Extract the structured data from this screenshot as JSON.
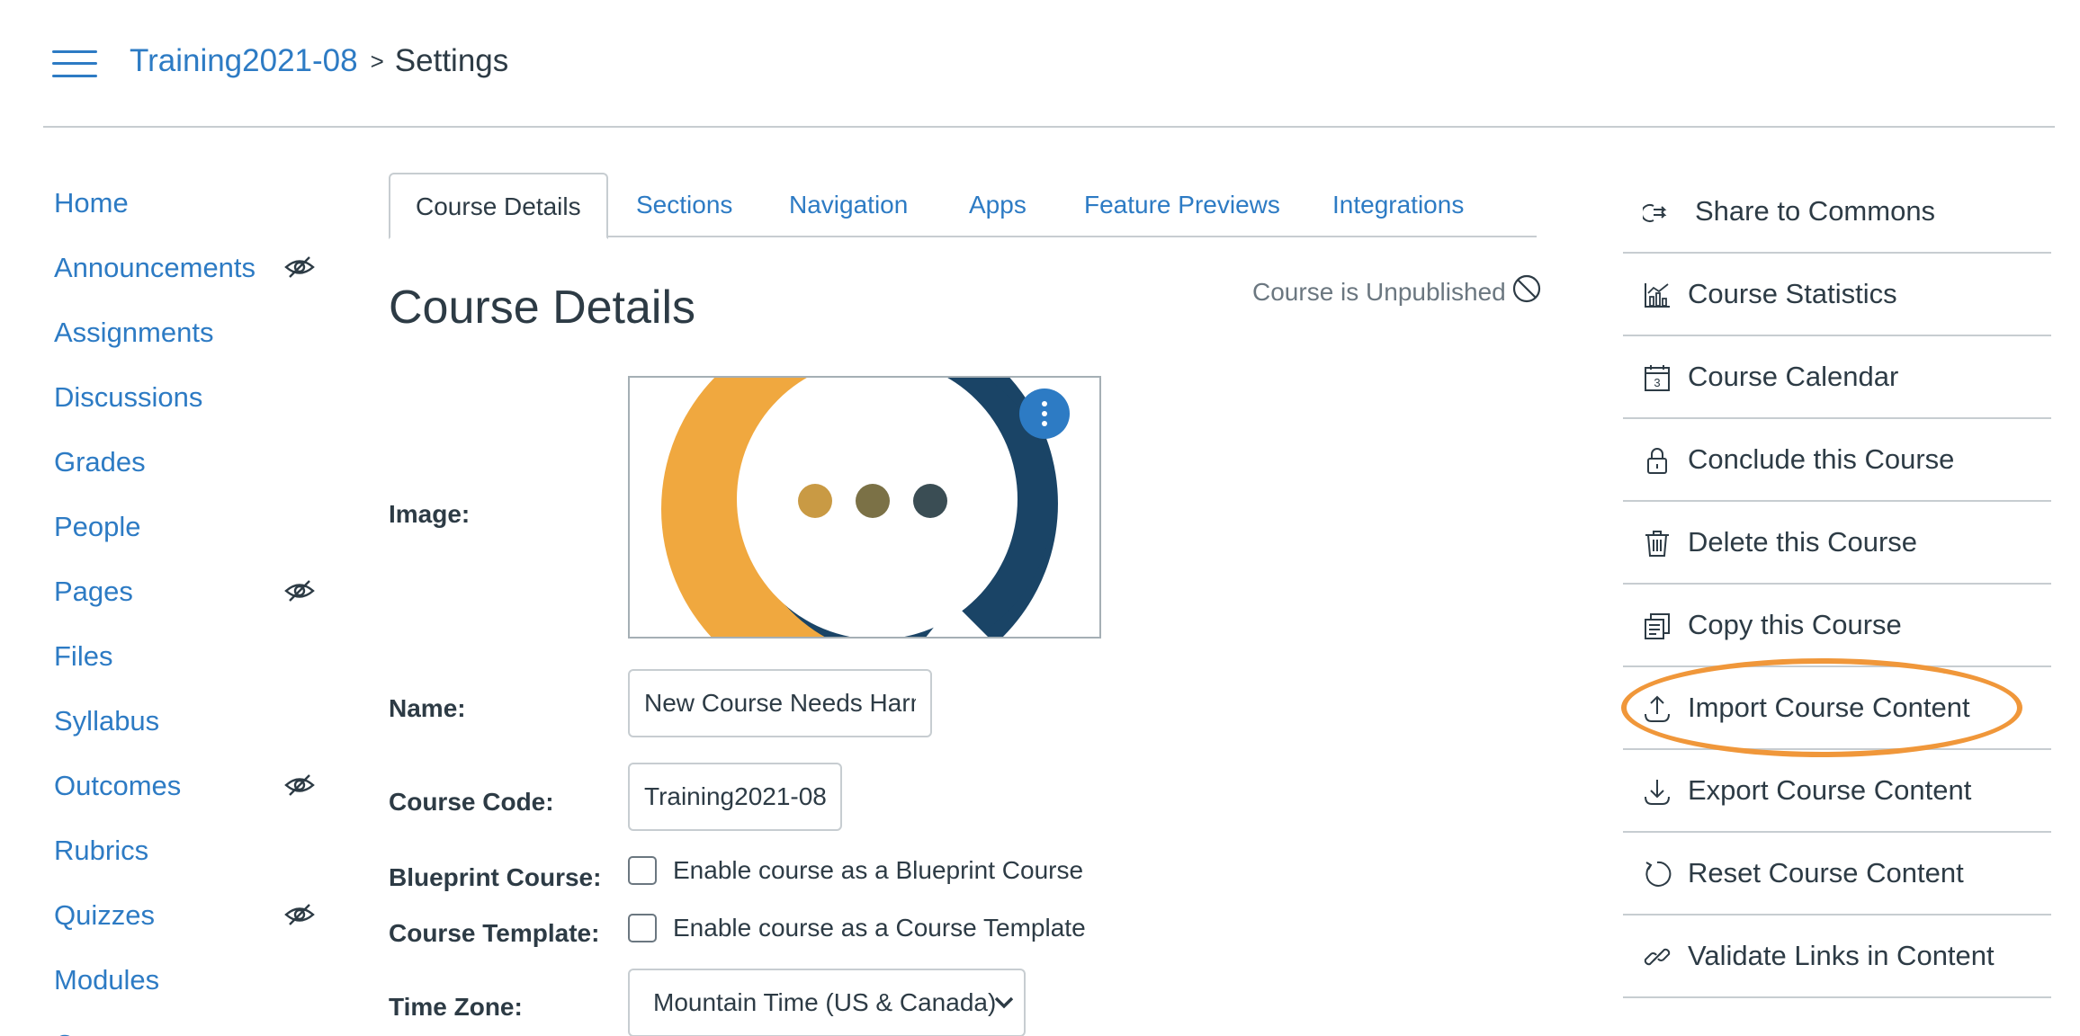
{
  "header": {
    "course_link": "Training2021-08",
    "separator": ">",
    "current_page": "Settings"
  },
  "course_nav": {
    "items": [
      {
        "label": "Home",
        "hidden_icon": false
      },
      {
        "label": "Announcements",
        "hidden_icon": true
      },
      {
        "label": "Assignments",
        "hidden_icon": false
      },
      {
        "label": "Discussions",
        "hidden_icon": false
      },
      {
        "label": "Grades",
        "hidden_icon": false
      },
      {
        "label": "People",
        "hidden_icon": false
      },
      {
        "label": "Pages",
        "hidden_icon": true
      },
      {
        "label": "Files",
        "hidden_icon": false
      },
      {
        "label": "Syllabus",
        "hidden_icon": false
      },
      {
        "label": "Outcomes",
        "hidden_icon": true
      },
      {
        "label": "Rubrics",
        "hidden_icon": false
      },
      {
        "label": "Quizzes",
        "hidden_icon": true
      },
      {
        "label": "Modules",
        "hidden_icon": false
      },
      {
        "label": "Co",
        "hidden_icon": false
      }
    ]
  },
  "tabs": [
    {
      "label": "Course Details",
      "active": true
    },
    {
      "label": "Sections",
      "active": false
    },
    {
      "label": "Navigation",
      "active": false
    },
    {
      "label": "Apps",
      "active": false
    },
    {
      "label": "Feature Previews",
      "active": false
    },
    {
      "label": "Integrations",
      "active": false
    }
  ],
  "main": {
    "title": "Course Details",
    "publish_status": "Course is Unpublished",
    "image_label": "Image:",
    "name_label": "Name:",
    "name_value": "New Course Needs Harmonizing",
    "code_label": "Course Code:",
    "code_value": "Training2021-08",
    "blueprint_label": "Blueprint Course:",
    "blueprint_checkbox": "Enable course as a Blueprint Course",
    "template_label": "Course Template:",
    "template_checkbox": "Enable course as a Course Template",
    "timezone_label": "Time Zone:",
    "timezone_value": "Mountain Time (US & Canada)"
  },
  "actions": [
    {
      "label": "Share to Commons",
      "icon": "share-icon"
    },
    {
      "label": "Course Statistics",
      "icon": "statistics-icon"
    },
    {
      "label": "Course Calendar",
      "icon": "calendar-icon",
      "calendar_day": "3"
    },
    {
      "label": "Conclude this Course",
      "icon": "lock-icon"
    },
    {
      "label": "Delete this Course",
      "icon": "trash-icon"
    },
    {
      "label": "Copy this Course",
      "icon": "copy-icon"
    },
    {
      "label": "Import Course Content",
      "icon": "upload-icon",
      "highlighted": true
    },
    {
      "label": "Export Course Content",
      "icon": "download-icon"
    },
    {
      "label": "Reset Course Content",
      "icon": "reset-icon"
    },
    {
      "label": "Validate Links in Content",
      "icon": "link-icon"
    }
  ],
  "colors": {
    "link": "#2d7bc4",
    "text": "#2d3b45",
    "muted": "#6b7780",
    "border": "#c7cdd1",
    "highlight": "#f0973a",
    "image_orange": "#f0a83f",
    "image_navy": "#1a4466"
  }
}
